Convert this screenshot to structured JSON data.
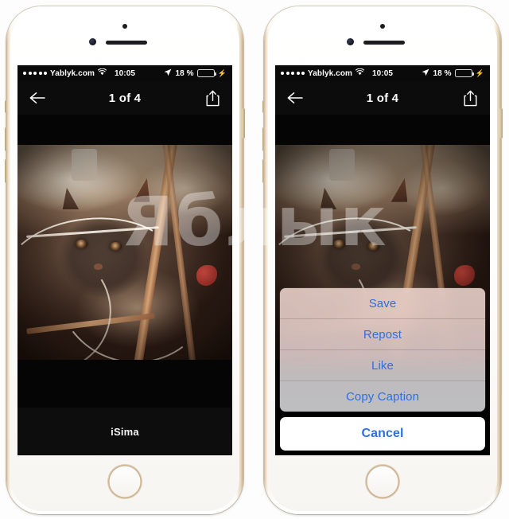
{
  "page": {
    "watermark": "Яблык"
  },
  "status_bar": {
    "signal_dots": 5,
    "carrier": "Yablyk.com",
    "wifi_icon": "wifi-icon",
    "time": "10:05",
    "location_icon": "location-arrow-icon",
    "battery_percent": "18 %",
    "battery_level": 18,
    "battery_color": "#e8322c",
    "charging_icon": "lightning-bolt-icon"
  },
  "nav_bar": {
    "back_icon": "back-arrow-icon",
    "title": "1 of 4",
    "share_icon": "share-icon"
  },
  "photo": {
    "caption": "iSima",
    "alt": "cat under white cables"
  },
  "action_sheet": {
    "accent_color": "#2f6fe0",
    "items": [
      {
        "label": "Save"
      },
      {
        "label": "Repost"
      },
      {
        "label": "Like"
      },
      {
        "label": "Copy Caption"
      }
    ],
    "cancel_label": "Cancel"
  },
  "phones": [
    {
      "id": "left",
      "state": "photo view"
    },
    {
      "id": "right",
      "state": "action sheet open"
    }
  ]
}
